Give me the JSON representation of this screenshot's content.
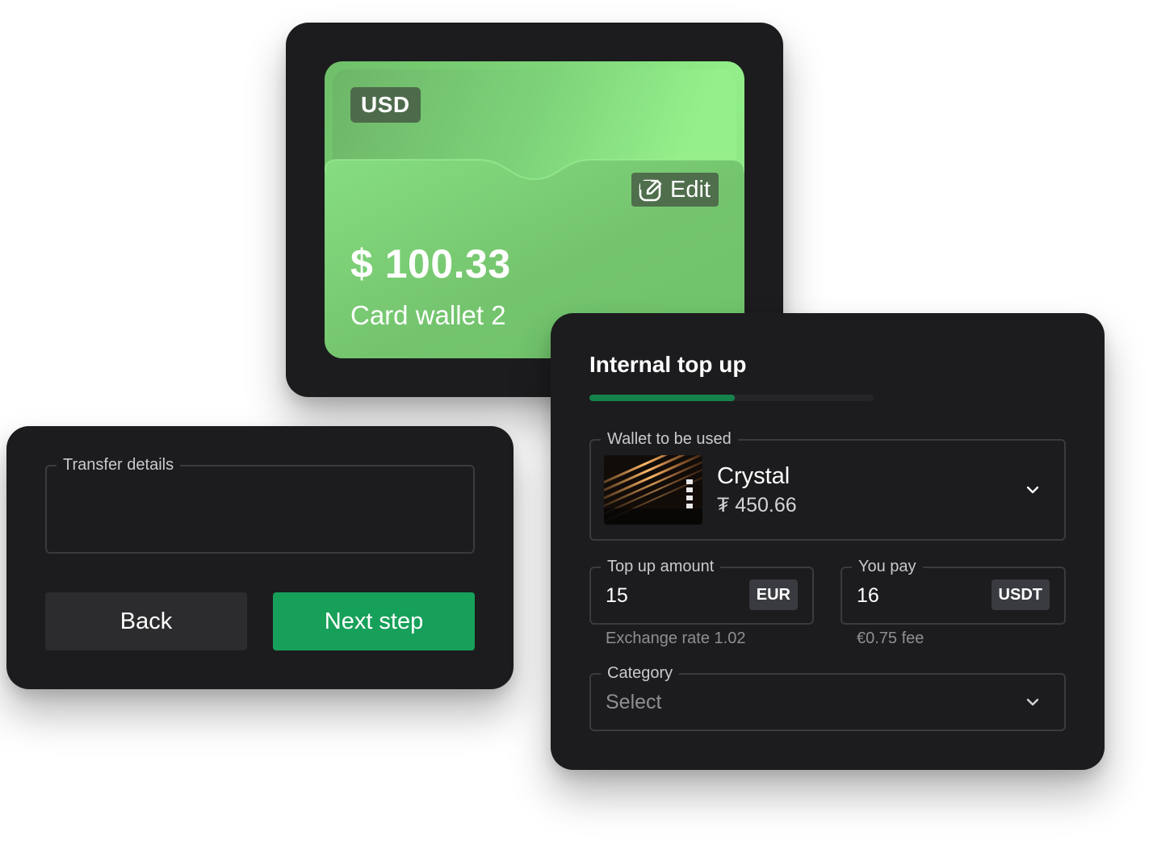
{
  "wallet_card": {
    "currency": "USD",
    "edit_label": "Edit",
    "balance": "$ 100.33",
    "name": "Card wallet 2"
  },
  "transfer": {
    "details_label": "Transfer details",
    "back_label": "Back",
    "next_label": "Next step"
  },
  "topup": {
    "title": "Internal top up",
    "progress": 0.51,
    "wallet_label": "Wallet to be used",
    "wallet_name": "Crystal",
    "wallet_balance": "₮ 450.66",
    "amount_label": "Top up amount",
    "amount_value": "15",
    "amount_currency": "EUR",
    "exchange_rate": "Exchange rate 1.02",
    "pay_label": "You pay",
    "pay_value": "16",
    "pay_currency": "USDT",
    "fee": "€0.75 fee",
    "category_label": "Category",
    "category_placeholder": "Select"
  },
  "colors": {
    "panel": "#1c1c1e",
    "accent_green": "#17a05a",
    "card_green": "#86e07f",
    "progress_green": "#15844c"
  },
  "icons": {
    "edit": "edit-pencil-icon",
    "chevron": "chevron-down-icon"
  }
}
